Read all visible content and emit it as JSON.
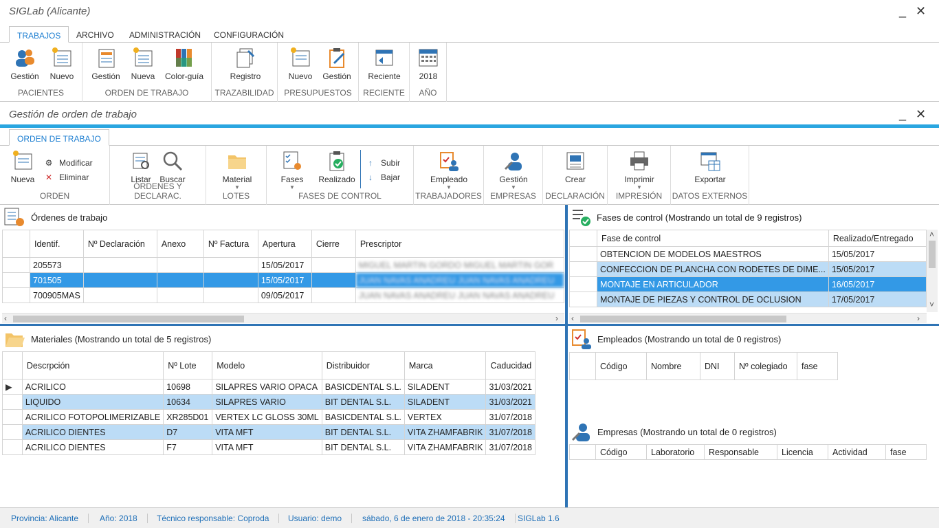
{
  "app": {
    "title": "SIGLab (Alicante)"
  },
  "ribbon_tabs": [
    "TRABAJOS",
    "ARCHIVO",
    "ADMINISTRACIÓN",
    "CONFIGURACIÓN"
  ],
  "ribbon": {
    "pacientes": {
      "label": "PACIENTES",
      "gestion": "Gestión",
      "nuevo": "Nuevo"
    },
    "orden": {
      "label": "ORDEN DE TRABAJO",
      "gestion": "Gestión",
      "nueva": "Nueva",
      "color": "Color-guía"
    },
    "traz": {
      "label": "TRAZABILIDAD",
      "registro": "Registro"
    },
    "presu": {
      "label": "PRESUPUESTOS",
      "nuevo": "Nuevo",
      "gestion": "Gestión"
    },
    "reciente": {
      "label": "RECIENTE",
      "reciente": "Reciente"
    },
    "anio": {
      "label": "AÑO",
      "value": "2018"
    }
  },
  "sub": {
    "title": "Gestión de orden de trabajo",
    "tab": "ORDEN DE TRABAJO"
  },
  "ribbon2": {
    "orden": {
      "label": "ORDEN",
      "nueva": "Nueva",
      "modificar": "Modificar",
      "eliminar": "Eliminar"
    },
    "ordenes": {
      "label": "ÓRDENES Y DECLARAC.",
      "listar": "Listar",
      "buscar": "Buscar"
    },
    "lotes": {
      "label": "LOTES",
      "material": "Material"
    },
    "fases": {
      "label": "FASES DE CONTROL",
      "fases": "Fases",
      "realizado": "Realizado",
      "subir": "Subir",
      "bajar": "Bajar"
    },
    "trab": {
      "label": "TRABAJADORES",
      "empleado": "Empleado"
    },
    "emp": {
      "label": "EMPRESAS",
      "gestion": "Gestión"
    },
    "decl": {
      "label": "DECLARACIÓN",
      "crear": "Crear"
    },
    "imp": {
      "label": "IMPRESIÓN",
      "imprimir": "Imprimir"
    },
    "datos": {
      "label": "DATOS EXTERNOS",
      "exportar": "Exportar"
    }
  },
  "ordenes": {
    "title": "Órdenes de trabajo",
    "cols": [
      "Identif.",
      "Nº Declaración",
      "Anexo",
      "Nº Factura",
      "Apertura",
      "Cierre",
      "Prescriptor"
    ],
    "rows": [
      {
        "id": "205573",
        "apertura": "15/05/2017",
        "presc": "MIGUEL MARTIN GORDO MIGUEL MARTIN GOR"
      },
      {
        "id": "701505",
        "apertura": "15/05/2017",
        "presc": "JUAN NAVAS ANADREU JUAN NAVAS ANADREU"
      },
      {
        "id": "700905MAS",
        "apertura": "09/05/2017",
        "presc": "JUAN NAVAS ANADREU JUAN NAVAS ANADREU"
      }
    ]
  },
  "fases": {
    "title": "Fases de control (Mostrando un total de 9 registros)",
    "cols": [
      "Fase de control",
      "Realizado/Entregado"
    ],
    "rows": [
      {
        "f": "OBTENCION DE MODELOS MAESTROS",
        "d": "15/05/2017"
      },
      {
        "f": "CONFECCION DE PLANCHA CON RODETES DE DIME...",
        "d": "15/05/2017"
      },
      {
        "f": "MONTAJE EN ARTICULADOR",
        "d": "16/05/2017"
      },
      {
        "f": "MONTAJE DE PIEZAS Y CONTROL DE OCLUSION",
        "d": "17/05/2017"
      }
    ]
  },
  "materiales": {
    "title": "Materiales (Mostrando un total de 5 registros)",
    "cols": [
      "Descrpción",
      "Nº Lote",
      "Modelo",
      "Distribuidor",
      "Marca",
      "Caducidad"
    ],
    "rows": [
      {
        "d": "ACRILICO",
        "l": "10698",
        "m": "SILAPRES VARIO OPACA",
        "di": "BASICDENTAL S.L.",
        "ma": "SILADENT",
        "c": "31/03/2021"
      },
      {
        "d": "LIQUIDO",
        "l": "10634",
        "m": "SILAPRES VARIO",
        "di": "BIT DENTAL S.L.",
        "ma": "SILADENT",
        "c": "31/03/2021"
      },
      {
        "d": "ACRILICO FOTOPOLIMERIZABLE",
        "l": "XR285D01",
        "m": "VERTEX LC GLOSS 30ML",
        "di": "BASICDENTAL S.L.",
        "ma": "VERTEX",
        "c": "31/07/2018"
      },
      {
        "d": "ACRILICO DIENTES",
        "l": "D7",
        "m": "VITA MFT",
        "di": "BIT DENTAL S.L.",
        "ma": "VITA ZHAMFABRIK",
        "c": "31/07/2018"
      },
      {
        "d": "ACRILICO DIENTES",
        "l": "F7",
        "m": "VITA MFT",
        "di": "BIT DENTAL S.L.",
        "ma": "VITA ZHAMFABRIK",
        "c": "31/07/2018"
      }
    ]
  },
  "empleados": {
    "title": "Empleados (Mostrando un total de 0 registros)",
    "cols": [
      "Código",
      "Nombre",
      "DNI",
      "Nº colegiado",
      "fase"
    ]
  },
  "empresas": {
    "title": "Empresas (Mostrando un total de 0 registros)",
    "cols": [
      "Código",
      "Laboratorio",
      "Responsable",
      "Licencia",
      "Actividad",
      "fase"
    ]
  },
  "status": [
    "Provincia: Alicante",
    "Año: 2018",
    "Técnico responsable: Coproda",
    "Usuario: demo",
    "sábado, 6 de enero de 2018 - 20:35:24",
    "SIGLab 1.6"
  ]
}
